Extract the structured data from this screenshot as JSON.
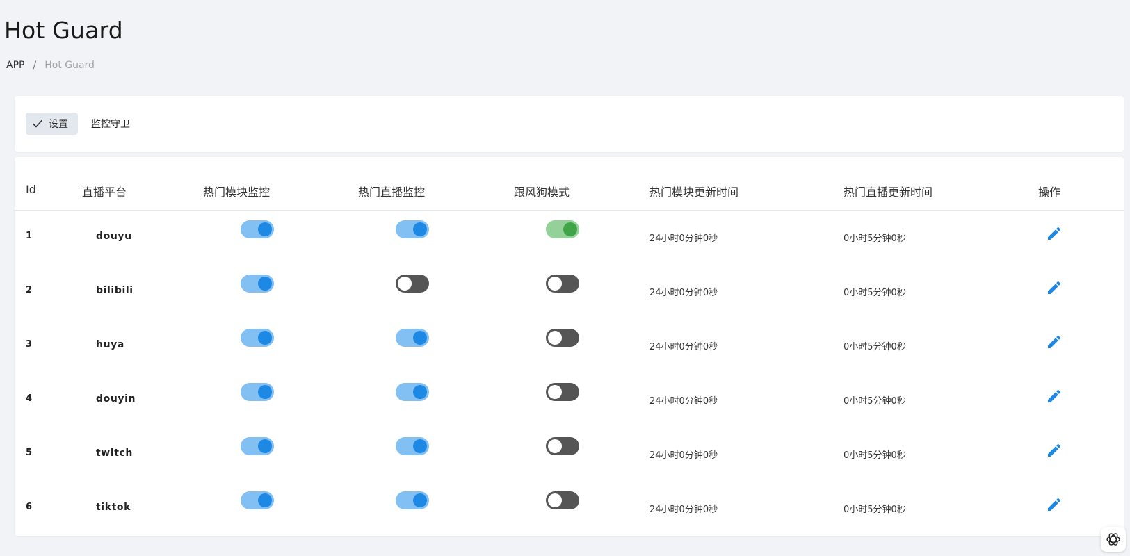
{
  "page": {
    "title": "Hot Guard",
    "breadcrumb": [
      {
        "label": "APP"
      },
      {
        "label": "Hot Guard"
      }
    ],
    "breadcrumb_separator": "/"
  },
  "tabs": [
    {
      "label": "设置",
      "active": true,
      "icon": "check-icon"
    },
    {
      "label": "监控守卫",
      "active": false
    }
  ],
  "table": {
    "columns": [
      {
        "key": "id",
        "label": "Id"
      },
      {
        "key": "platform",
        "label": "直播平台"
      },
      {
        "key": "hot_module_monitor",
        "label": "热门模块监控"
      },
      {
        "key": "hot_live_monitor",
        "label": "热门直播监控"
      },
      {
        "key": "follow_mode",
        "label": "跟风狗模式"
      },
      {
        "key": "module_update_time",
        "label": "热门模块更新时间"
      },
      {
        "key": "live_update_time",
        "label": "热门直播更新时间"
      },
      {
        "key": "actions",
        "label": "操作"
      }
    ],
    "rows": [
      {
        "id": "1",
        "platform": "douyu",
        "hot_module_monitor": true,
        "hot_live_monitor": true,
        "follow_mode": true,
        "module_update_time": "24小时0分钟0秒",
        "live_update_time": "0小时5分钟0秒"
      },
      {
        "id": "2",
        "platform": "bilibili",
        "hot_module_monitor": true,
        "hot_live_monitor": false,
        "follow_mode": false,
        "module_update_time": "24小时0分钟0秒",
        "live_update_time": "0小时5分钟0秒"
      },
      {
        "id": "3",
        "platform": "huya",
        "hot_module_monitor": true,
        "hot_live_monitor": true,
        "follow_mode": false,
        "module_update_time": "24小时0分钟0秒",
        "live_update_time": "0小时5分钟0秒"
      },
      {
        "id": "4",
        "platform": "douyin",
        "hot_module_monitor": true,
        "hot_live_monitor": true,
        "follow_mode": false,
        "module_update_time": "24小时0分钟0秒",
        "live_update_time": "0小时5分钟0秒"
      },
      {
        "id": "5",
        "platform": "twitch",
        "hot_module_monitor": true,
        "hot_live_monitor": true,
        "follow_mode": false,
        "module_update_time": "24小时0分钟0秒",
        "live_update_time": "0小时5分钟0秒"
      },
      {
        "id": "6",
        "platform": "tiktok",
        "hot_module_monitor": true,
        "hot_live_monitor": true,
        "follow_mode": false,
        "module_update_time": "24小时0分钟0秒",
        "live_update_time": "0小时5分钟0秒"
      }
    ],
    "action_icon": "pencil-icon"
  },
  "colors": {
    "toggle_on_track": "#82bff2",
    "toggle_on_knob": "#1e88e5",
    "toggle_green_track": "#93d198",
    "toggle_green_knob": "#3fa548",
    "toggle_off_track": "#555555",
    "edit_icon": "#1e88e5"
  }
}
